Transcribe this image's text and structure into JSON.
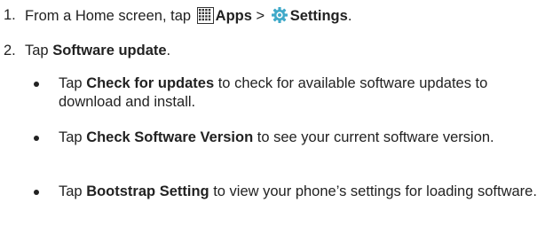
{
  "steps": [
    {
      "number": "1.",
      "pre": "From a Home screen, tap ",
      "apps_label": "Apps",
      "separator": " > ",
      "settings_label": "Settings",
      "post": "."
    },
    {
      "number": "2.",
      "pre": "Tap ",
      "bold": "Software update",
      "post": "."
    }
  ],
  "bullets": [
    {
      "pre": "Tap ",
      "bold": "Check for updates",
      "post": " to check for available software updates to download and install."
    },
    {
      "pre": "Tap ",
      "bold": "Check Software Version",
      "post": " to see your current software version."
    },
    {
      "pre": "Tap ",
      "bold": "Bootstrap Setting",
      "post": " to view your phone’s settings for loading software."
    }
  ],
  "icons": {
    "apps": "apps-grid-icon",
    "settings": "settings-gear-icon",
    "settings_color": "#3fa9c9"
  }
}
